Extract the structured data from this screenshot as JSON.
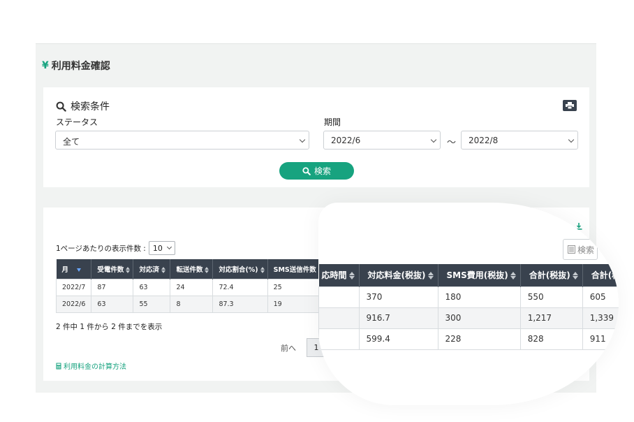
{
  "page": {
    "title": "利用料金確認",
    "title_icon": "yen-icon"
  },
  "search": {
    "title": "検索条件",
    "status_label": "ステータス",
    "status_value": "全て",
    "period_label": "期間",
    "period_from": "2022/6",
    "period_separator": "〜",
    "period_to": "2022/8",
    "button_label": "検索"
  },
  "results": {
    "per_page_label": "1ページあたりの表示件数 :",
    "per_page_value": "10",
    "columns": [
      "月",
      "受電件数",
      "対応済",
      "転送件数",
      "対応割合(%)",
      "SMS送信件数"
    ],
    "rows": [
      [
        "2022/7",
        "87",
        "63",
        "24",
        "72.4",
        "25"
      ],
      [
        "2022/6",
        "63",
        "55",
        "8",
        "87.3",
        "19"
      ]
    ],
    "info": "2 件中 1 件から 2 件までを表示",
    "prev_label": "前へ",
    "current_page": "1",
    "calc_link": "利用料金の計算方法"
  },
  "zoom": {
    "search_button_label": "検索",
    "columns": [
      "応時間",
      "対応料金(税抜)",
      "SMS費用(税抜)",
      "合計(税抜)",
      "合計(税込)"
    ],
    "rows": [
      [
        "",
        "370",
        "180",
        "550",
        "605"
      ],
      [
        "",
        "916.7",
        "300",
        "1,217",
        "1,339"
      ],
      [
        "",
        "599.4",
        "228",
        "828",
        "911"
      ]
    ]
  },
  "colors": {
    "accent": "#17a37f",
    "header_dark": "#39424e",
    "background": "#f1f3f2"
  }
}
